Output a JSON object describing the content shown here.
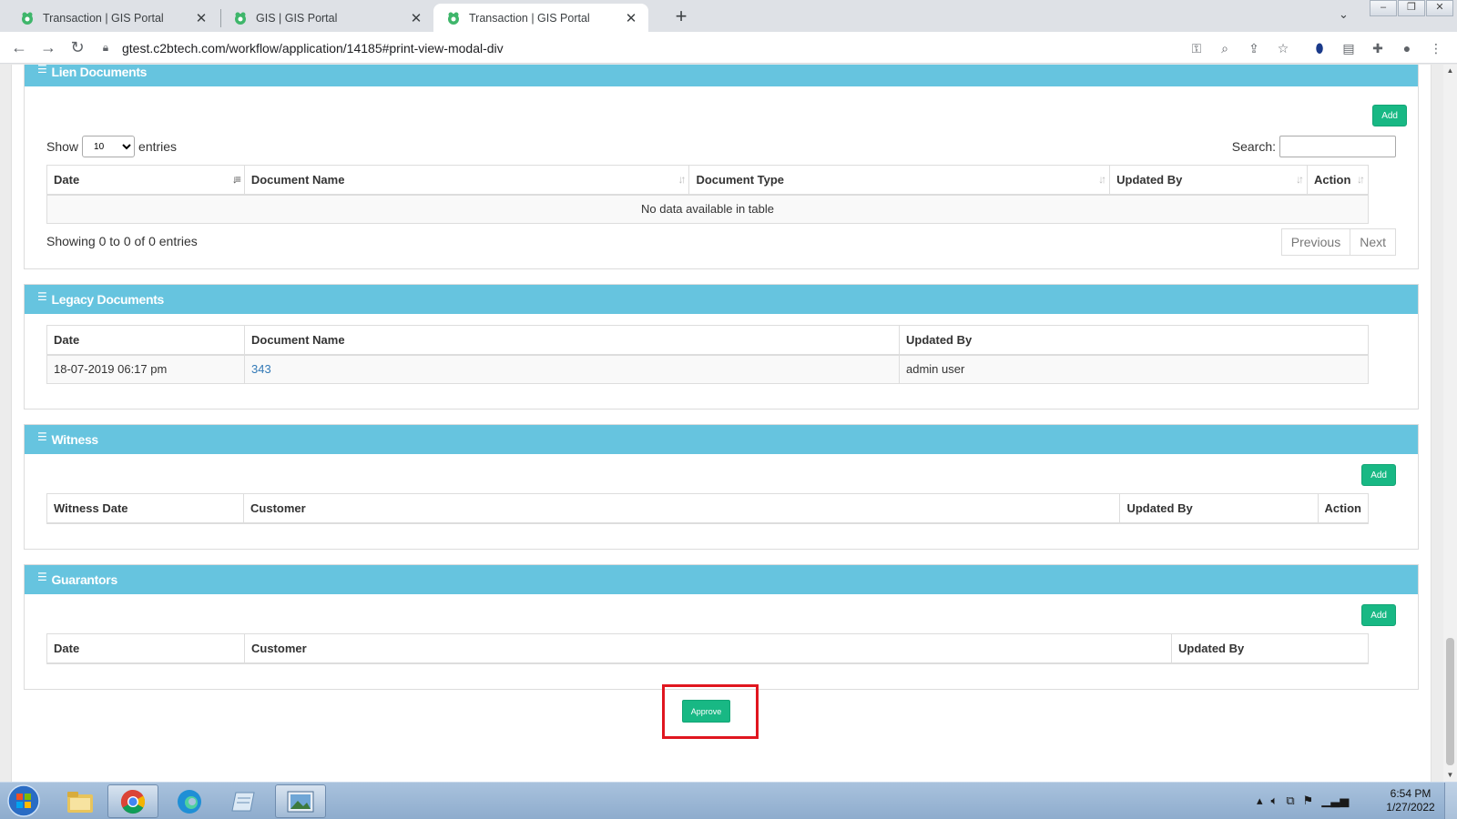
{
  "browser": {
    "tabs": [
      {
        "title": "Transaction | GIS Portal",
        "active": false
      },
      {
        "title": "GIS | GIS Portal",
        "active": false
      },
      {
        "title": "Transaction | GIS Portal",
        "active": true
      }
    ],
    "url": "gtest.c2btech.com/workflow/application/14185#print-view-modal-div"
  },
  "lien": {
    "title": "Lien Documents",
    "add_label": "Add",
    "show_label": "Show",
    "entries_label": "entries",
    "page_length": "10",
    "search_label": "Search:",
    "columns": [
      "Date",
      "Document Name",
      "Document Type",
      "Updated By",
      "Action"
    ],
    "empty_text": "No data available in table",
    "info": "Showing 0 to 0 of 0 entries",
    "prev_label": "Previous",
    "next_label": "Next"
  },
  "legacy": {
    "title": "Legacy Documents",
    "columns": [
      "Date",
      "Document Name",
      "Updated By"
    ],
    "rows": [
      {
        "date": "18-07-2019 06:17 pm",
        "document_name": "343",
        "updated_by": "admin user"
      }
    ]
  },
  "witness": {
    "title": "Witness",
    "add_label": "Add",
    "columns": [
      "Witness Date",
      "Customer",
      "Updated By",
      "Action"
    ]
  },
  "guarantors": {
    "title": "Guarantors",
    "add_label": "Add",
    "columns": [
      "Date",
      "Customer",
      "Updated By"
    ]
  },
  "approve_label": "Approve",
  "taskbar": {
    "time": "6:54 PM",
    "date": "1/27/2022"
  },
  "colors": {
    "panel_header": "#66c4df",
    "button_green": "#18b884",
    "highlight_red": "#e0161f"
  }
}
